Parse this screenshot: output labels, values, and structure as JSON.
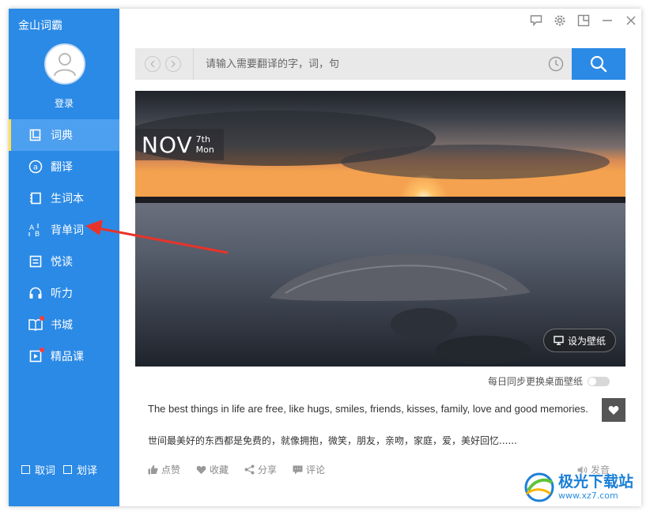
{
  "app": {
    "title": "金山词霸"
  },
  "sidebar": {
    "login_label": "登录",
    "items": [
      {
        "label": "词典",
        "icon": "book-icon",
        "active": true
      },
      {
        "label": "翻译",
        "icon": "translate-icon"
      },
      {
        "label": "生词本",
        "icon": "notebook-icon"
      },
      {
        "label": "背单词",
        "icon": "vocab-icon"
      },
      {
        "label": "悦读",
        "icon": "reading-icon"
      },
      {
        "label": "听力",
        "icon": "headphones-icon"
      },
      {
        "label": "书城",
        "icon": "bookstore-icon",
        "badge": true
      },
      {
        "label": "精品课",
        "icon": "course-icon",
        "badge": true
      }
    ],
    "options": {
      "pick_word": "取词",
      "select_translate": "划译"
    }
  },
  "search": {
    "placeholder": "请输入需要翻译的字，词，句"
  },
  "hero": {
    "month": "NOV",
    "day": "7th",
    "weekday": "Mon",
    "wallpaper_button": "设为壁纸"
  },
  "sync": {
    "label": "每日同步更换桌面壁纸",
    "enabled": false
  },
  "quote": {
    "en": "The best things in life are free, like hugs, smiles, friends, kisses, family, love and good memories.",
    "cn": "世间最美好的东西都是免费的，就像拥抱，微笑，朋友，亲吻，家庭，爱，美好回忆......"
  },
  "actions": {
    "like": "点赞",
    "collect": "收藏",
    "share": "分享",
    "comment": "评论",
    "speak": "发音"
  },
  "watermark": {
    "name": "极光下载站",
    "url": "www.xz7.com"
  },
  "colors": {
    "accent": "#2b8ae6",
    "active_marker": "#ffe14a",
    "arrow": "#e8332b"
  }
}
